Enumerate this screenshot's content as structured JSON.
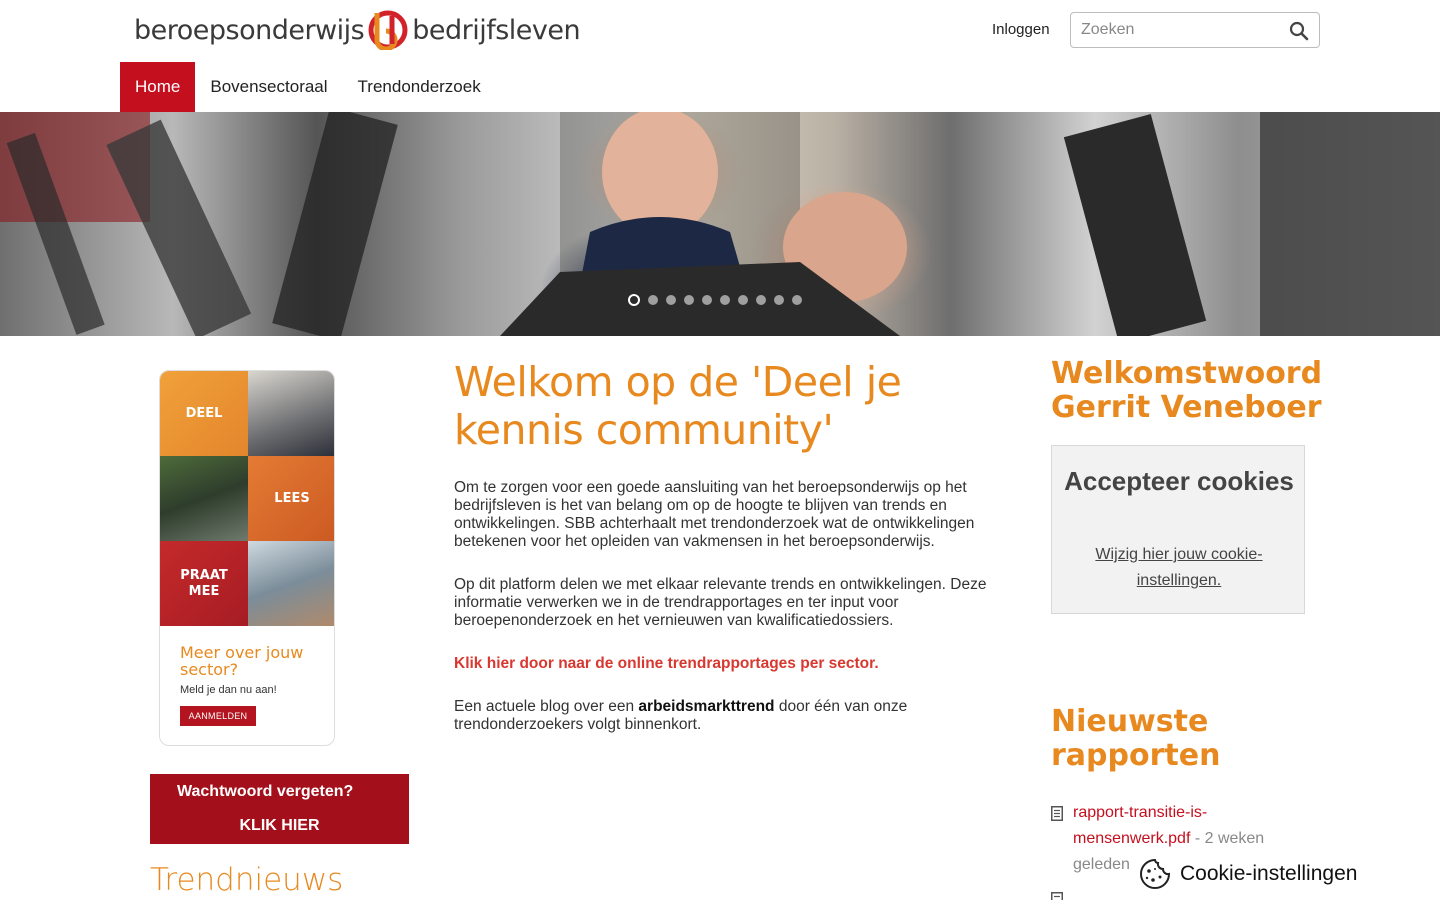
{
  "header": {
    "logo_left": "beroepsonderwijs",
    "logo_right": "bedrijfsleven",
    "login_label": "Inloggen",
    "search_placeholder": "Zoeken"
  },
  "nav": {
    "items": [
      "Home",
      "Bovensectoraal",
      "Trendonderzoek"
    ],
    "active": "Home"
  },
  "hero": {
    "slide_count": 10,
    "active_slide": 1
  },
  "promo": {
    "tile_deel": "DEEL",
    "tile_lees": "LEES",
    "tile_praat_line1": "PRAAT",
    "tile_praat_line2": "MEE",
    "title": "Meer over jouw sector?",
    "subtitle": "Meld je dan nu aan!",
    "button": "AANMELDEN"
  },
  "password_box": {
    "title": "Wachtwoord vergeten?",
    "link": "KLIK HIER"
  },
  "trendnieuws_heading": "Trendnieuws",
  "main": {
    "heading": "Welkom op de 'Deel je kennis community'",
    "p1": "Om te zorgen voor een goede aansluiting van het beroepsonderwijs op het bedrijfsleven is het van belang om op de hoogte te blijven van trends en ontwikkelingen. SBB achterhaalt met trendonderzoek  wat de ontwikkelingen betekenen voor het opleiden van vakmensen in het beroepsonderwijs.",
    "p2": "Op dit platform delen we met elkaar relevante trends en ontwikkelingen. Deze informatie verwerken we in de trendrapportages en ter input voor beroepenonderzoek en het vernieuwen van kwalificatiedossiers.",
    "link": "Klik hier door naar de online trendrapportages per sector.",
    "p4_before": "Een actuele blog over een ",
    "p4_bold": "arbeidsmarkttrend",
    "p4_after": " door één van onze trendonderzoekers volgt binnenkort."
  },
  "sidebar": {
    "welcome_heading": "Welkomstwoord Gerrit Veneboer",
    "cookie_box_title": "Accepteer cookies",
    "cookie_box_link": "Wijzig hier jouw cookie-instellingen.",
    "reports_heading": "Nieuwste rapporten",
    "report_file": "rapport-transitie-is-mensenwerk.pdf",
    "report_age": " - 2 weken geleden"
  },
  "cookie_settings_label": "Cookie-instellingen",
  "colors": {
    "brand_red": "#c40f1e",
    "dark_red": "#a3101b",
    "orange": "#e8891f",
    "link_red": "#d8382f"
  }
}
